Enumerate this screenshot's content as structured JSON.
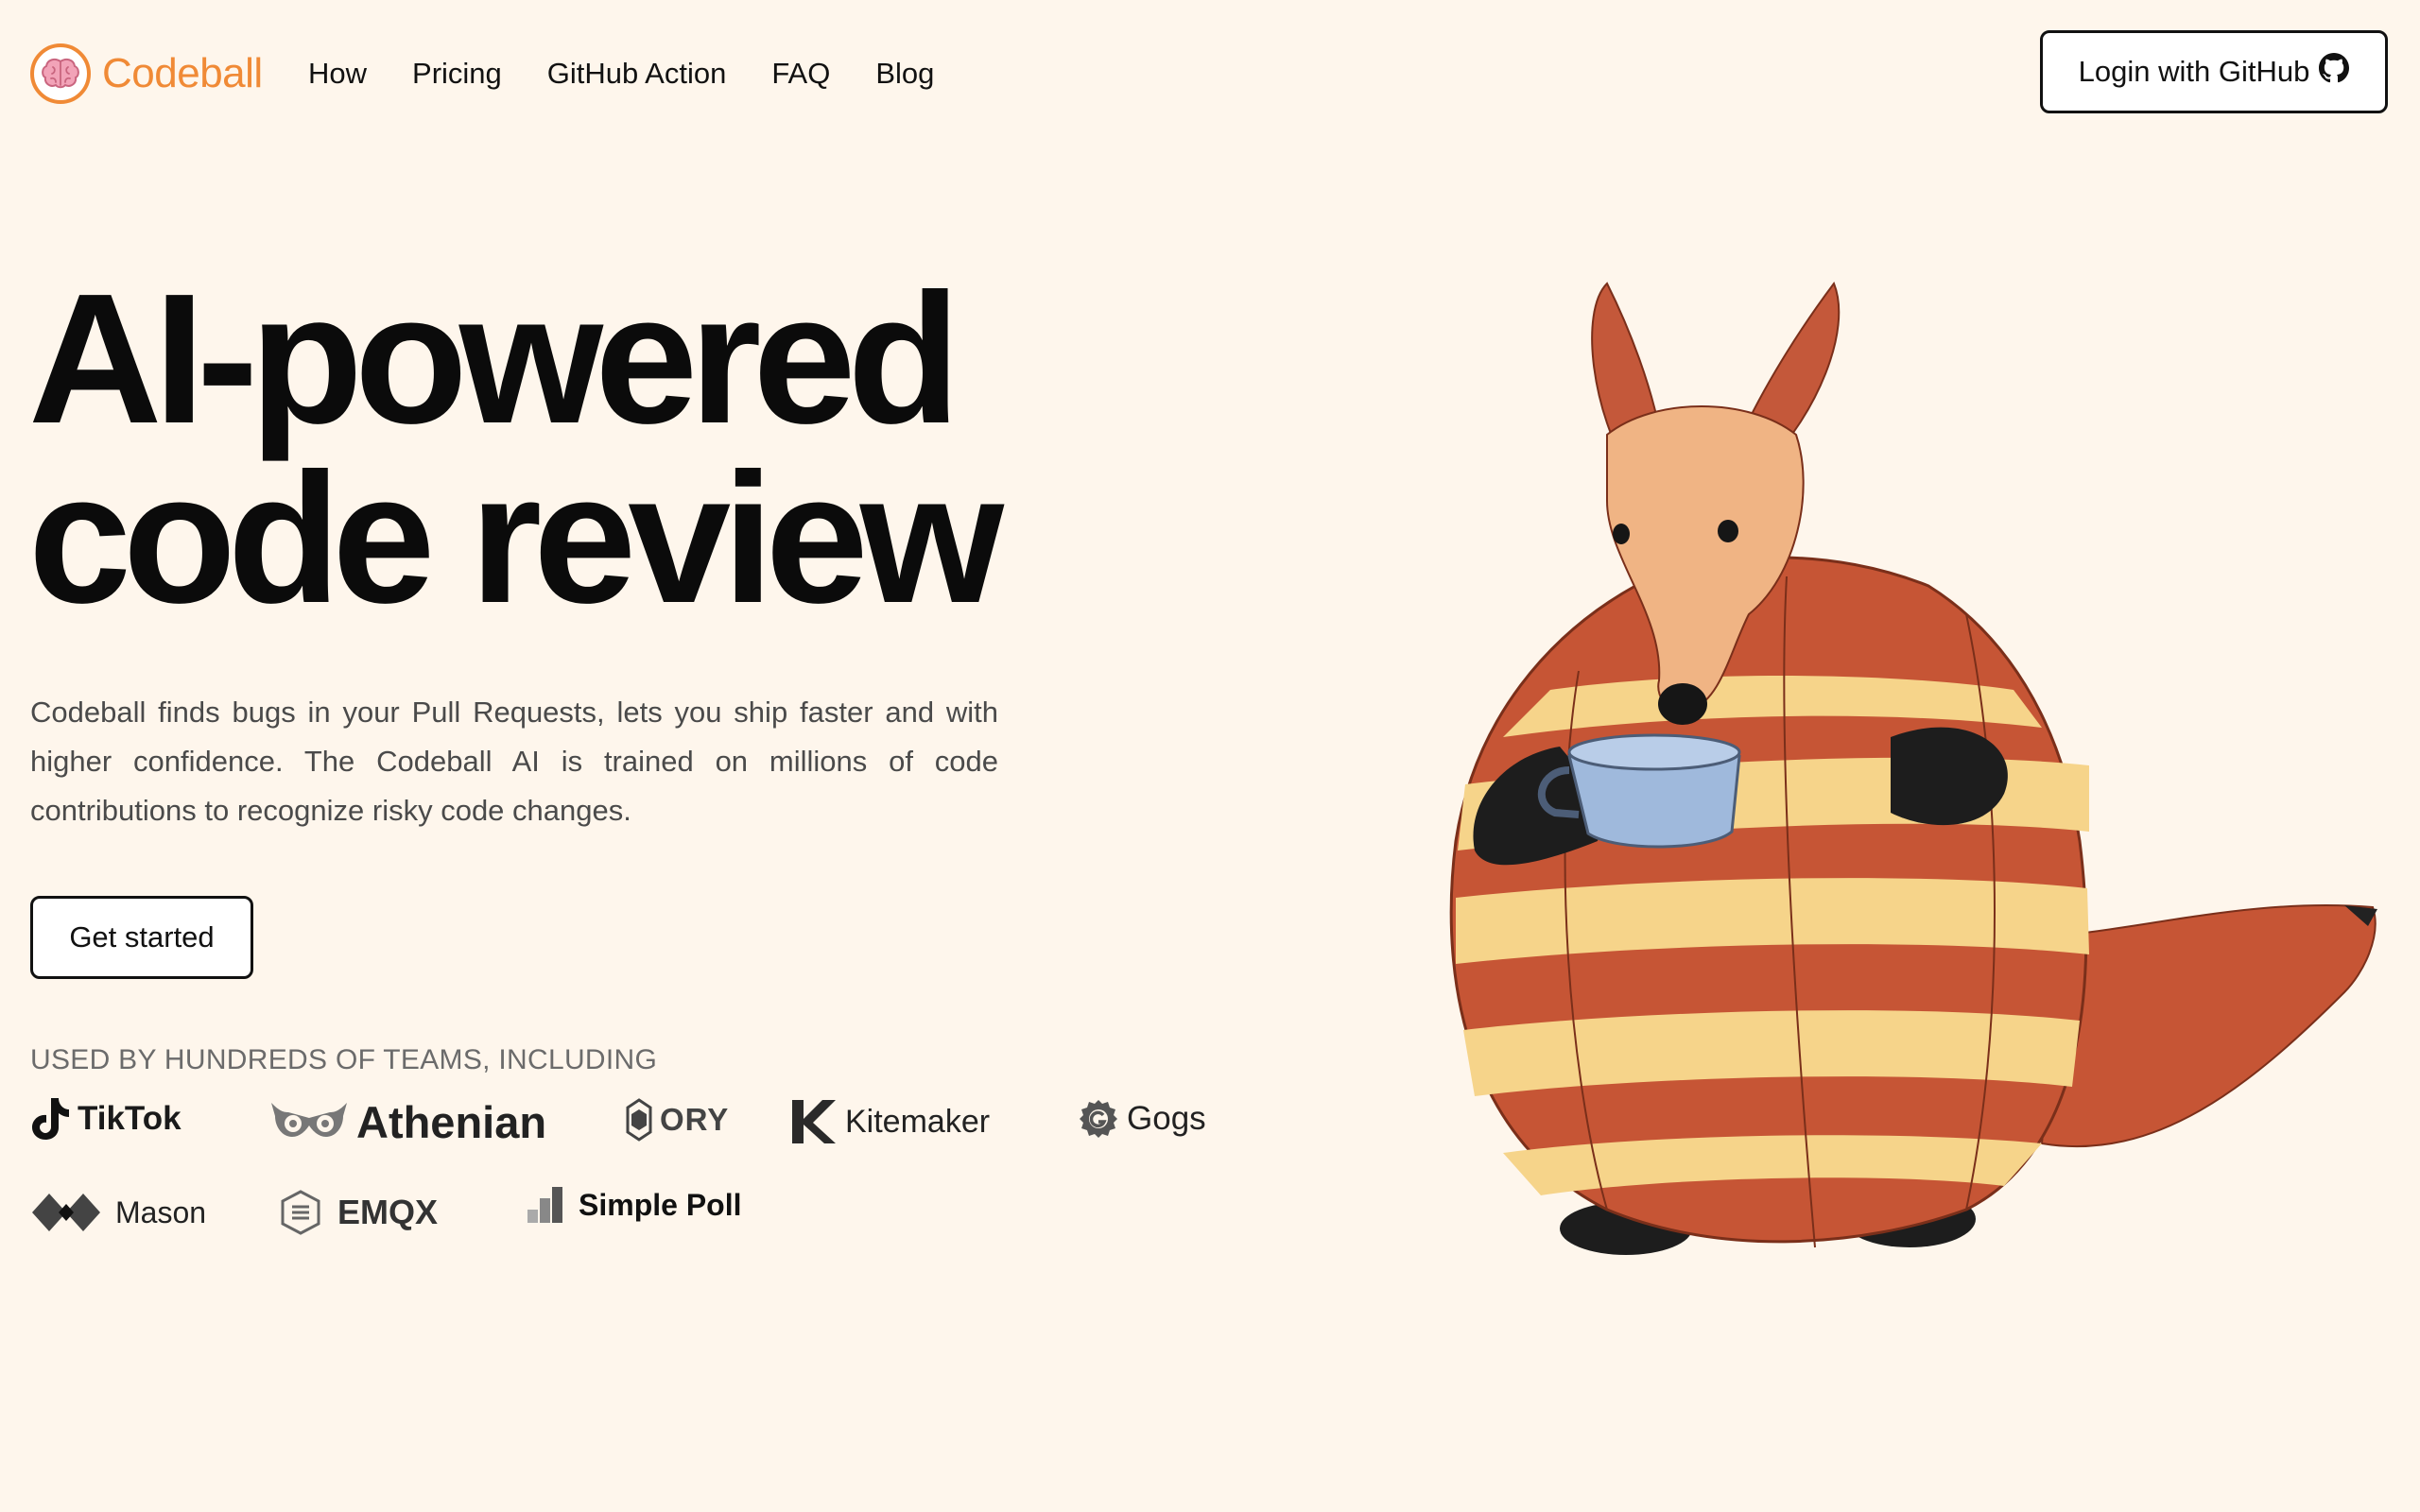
{
  "brand": {
    "name": "Codeball",
    "color": "#f08a36",
    "icon": "brain-icon"
  },
  "nav": {
    "items": [
      {
        "label": "How"
      },
      {
        "label": "Pricing"
      },
      {
        "label": "GitHub Action"
      },
      {
        "label": "FAQ"
      },
      {
        "label": "Blog"
      }
    ]
  },
  "login": {
    "label": "Login with GitHub",
    "icon": "github-icon"
  },
  "hero": {
    "title_line1": "AI-powered",
    "title_line2": "code review",
    "description": "Codeball finds bugs in your Pull Requests, lets you ship faster and with higher confidence. The Codeball AI is trained on millions of code contributions to recognize risky code changes.",
    "cta_label": "Get started"
  },
  "customers": {
    "heading": "USED BY HUNDREDS OF TEAMS, INCLUDING",
    "logos": [
      {
        "name": "TikTok"
      },
      {
        "name": "Athenian"
      },
      {
        "name": "ORY"
      },
      {
        "name": "Kitemaker"
      },
      {
        "name": "Gogs"
      },
      {
        "name": "Mason"
      },
      {
        "name": "EMQX"
      },
      {
        "name": "Simple Poll"
      }
    ]
  },
  "mascot": {
    "icon": "aardvark-mascot-illustration"
  },
  "colors": {
    "background": "#fef6ec",
    "accent": "#f08a36",
    "text": "#111111",
    "muted": "#6b6b6b"
  }
}
